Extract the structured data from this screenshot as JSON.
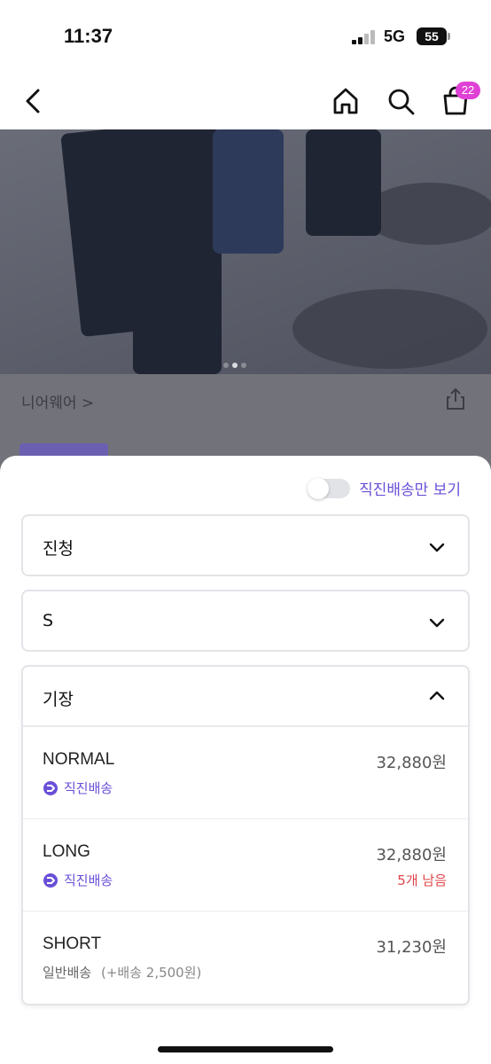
{
  "status_bar": {
    "time": "11:37",
    "network": "5G",
    "battery": "55"
  },
  "nav": {
    "back_icon": "chevron-left-icon",
    "home_icon": "home-icon",
    "search_icon": "search-icon",
    "cart_icon": "shopping-bag-icon",
    "cart_count": "22"
  },
  "product": {
    "brand": "니어웨어 >"
  },
  "sheet": {
    "direct_only_label": "직진배송만 보기",
    "selects": [
      {
        "label": "진청"
      },
      {
        "label": "S"
      }
    ],
    "open_select": {
      "label": "기장",
      "options": [
        {
          "name": "NORMAL",
          "price": "32,880원",
          "shipping": "직진배송",
          "stock": ""
        },
        {
          "name": "LONG",
          "price": "32,880원",
          "shipping": "직진배송",
          "stock": "5개 남음"
        },
        {
          "name": "SHORT",
          "price": "31,230원",
          "shipping": "일반배송",
          "shipping_extra": "(+배송 2,500원)",
          "stock": ""
        }
      ]
    }
  },
  "colors": {
    "accent": "#6a4fd8",
    "badge": "#e040d6",
    "stock_warning": "#e0454a"
  }
}
